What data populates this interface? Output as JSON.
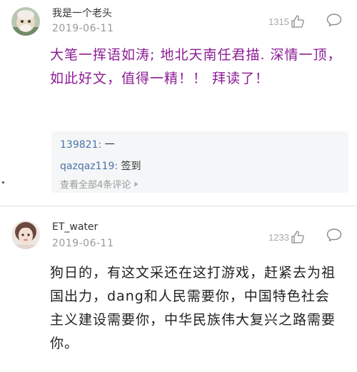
{
  "comments": [
    {
      "username": "我是一个老头",
      "date": "2019-06-11",
      "likes": "1315",
      "text": "大笔一挥语如涛; 地北天南任君描. 深情一顶，如此好文，值得一精！！ 拜读了！",
      "avatar_icon": "avatar-image",
      "like_icon": "thumbs-up-icon",
      "reply_icon": "speech-bubble-icon",
      "text_color": "#8c1c94",
      "replies": [
        {
          "name": "139821",
          "sep": ":",
          "text": " 一"
        },
        {
          "name": "qazqaz119",
          "sep": ":",
          "text": " 签到"
        }
      ],
      "view_all": "查看全部4条评论",
      "view_all_icon": "triangle-right-icon"
    },
    {
      "username": "ET_water",
      "date": "2019-06-11",
      "likes": "1233",
      "text": "狗日的，有这文采还在这打游戏，赶紧去为祖国出力，dang和人民需要你，中国特色社会主义建设需要你，中华民族伟大复兴之路需要你。",
      "avatar_icon": "avatar-image",
      "like_icon": "thumbs-up-icon",
      "reply_icon": "speech-bubble-icon",
      "text_color": "#222222"
    }
  ]
}
